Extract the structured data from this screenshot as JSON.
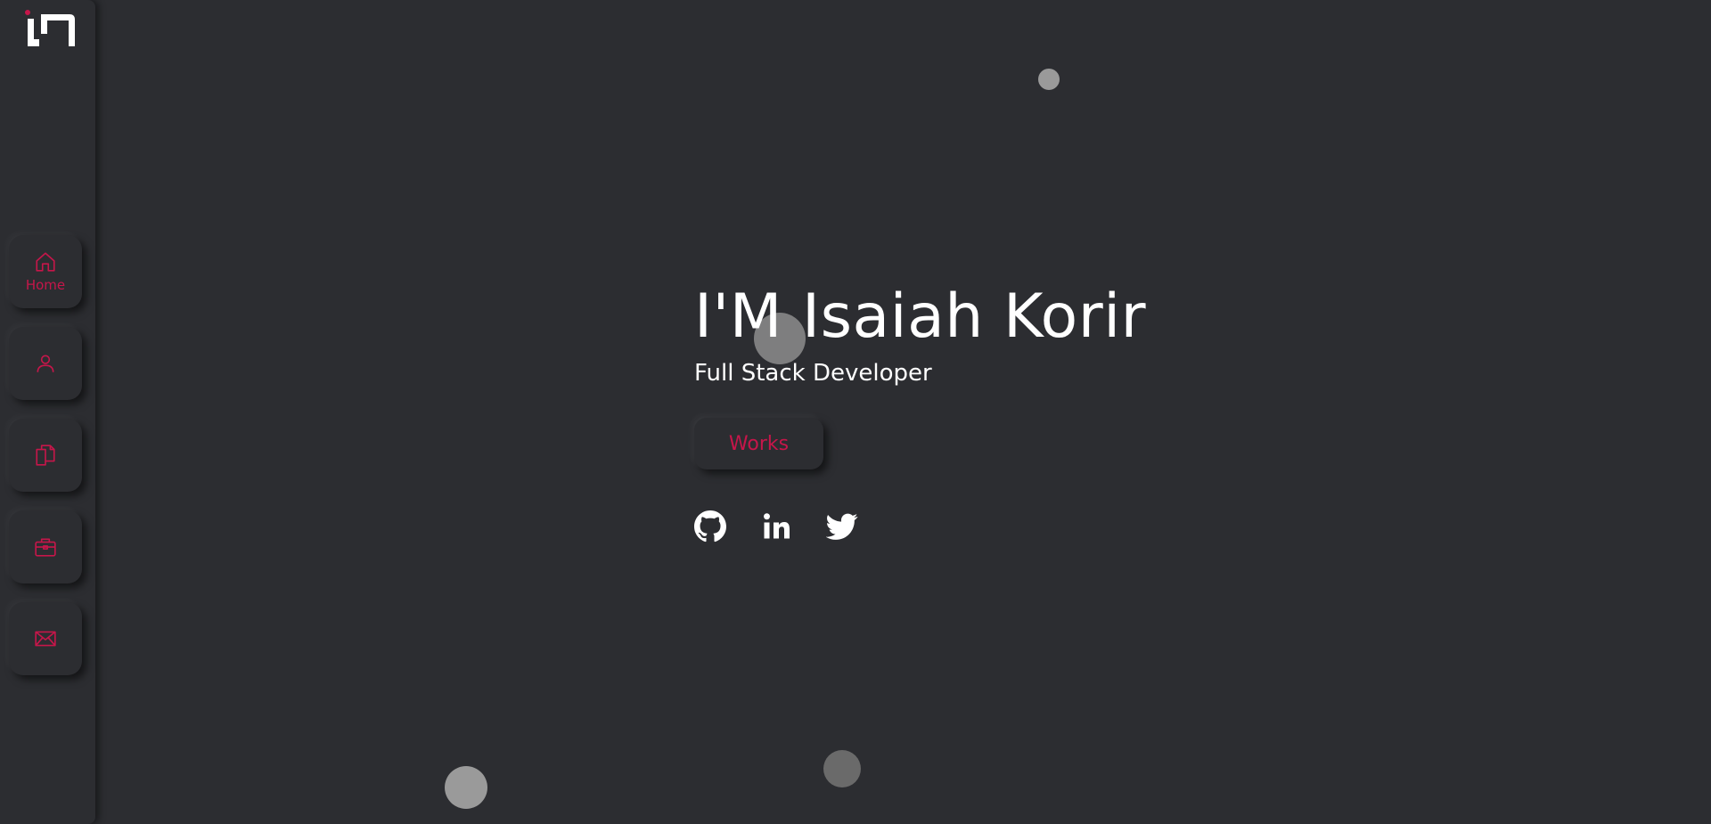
{
  "sidebar": {
    "logo_icon": "brand-logo-icon",
    "items": [
      {
        "icon": "home-icon",
        "label": "Home"
      },
      {
        "icon": "user-icon",
        "label": ""
      },
      {
        "icon": "document-icon",
        "label": ""
      },
      {
        "icon": "briefcase-icon",
        "label": ""
      },
      {
        "icon": "mail-icon",
        "label": ""
      }
    ]
  },
  "hero": {
    "title": "I'M Isaiah Korir",
    "subtitle": "Full Stack Developer",
    "works_label": "Works"
  },
  "socials": [
    {
      "icon": "github-icon"
    },
    {
      "icon": "linkedin-icon"
    },
    {
      "icon": "twitter-icon"
    }
  ],
  "colors": {
    "background": "#2c2d31",
    "accent": "#c6164a",
    "text": "#ffffff"
  }
}
